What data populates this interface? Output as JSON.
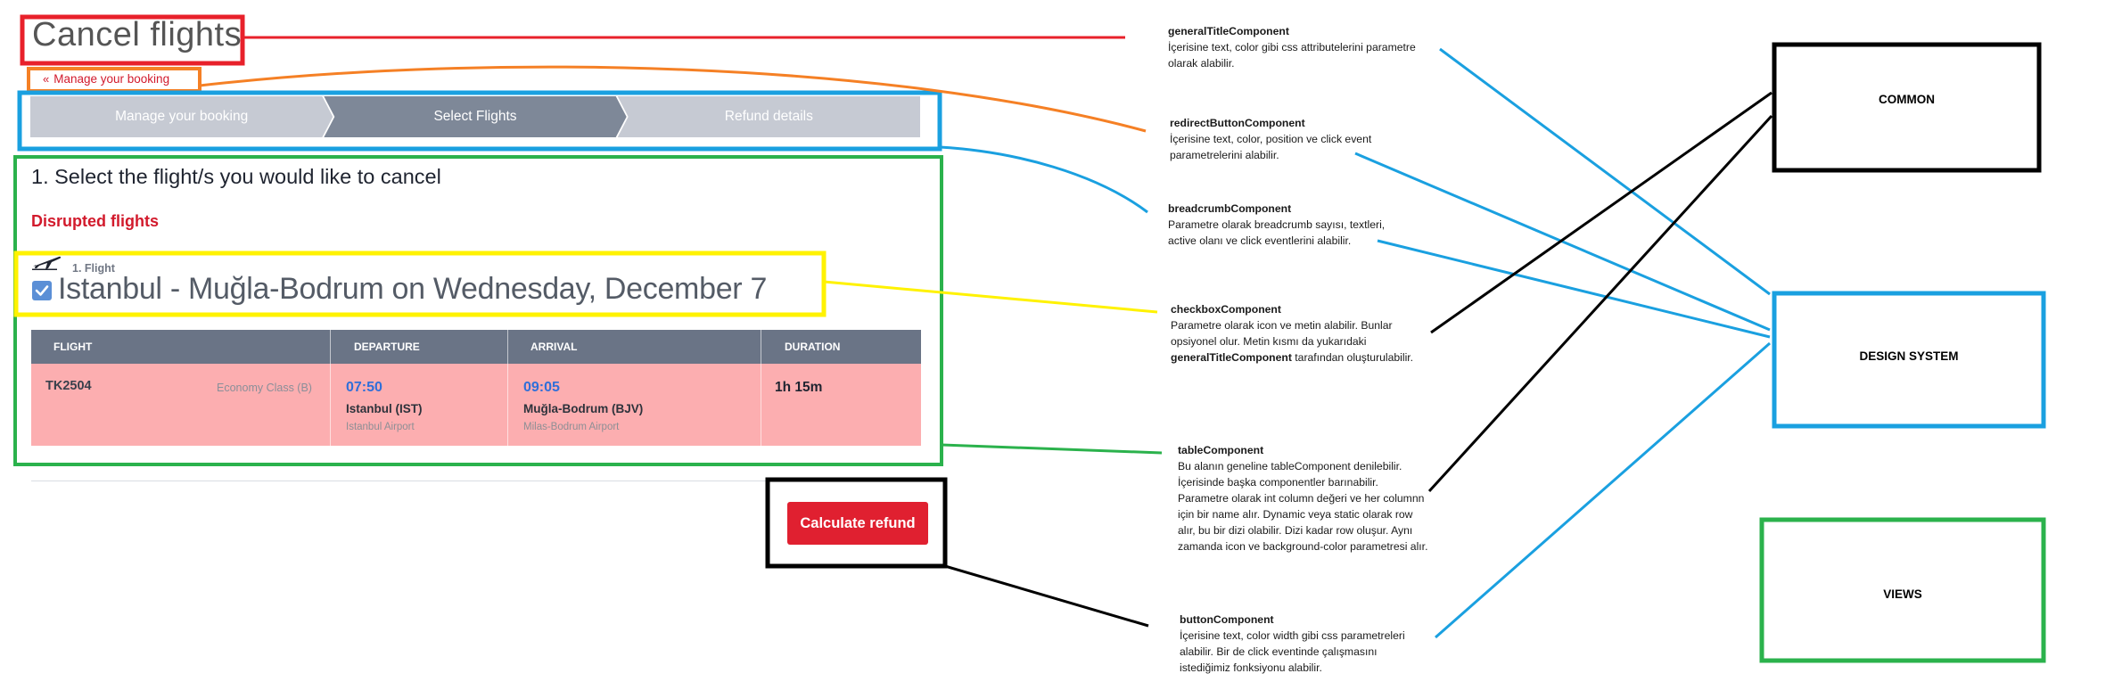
{
  "app": {
    "page_title": "Cancel flights",
    "redirect_label": "Manage your booking",
    "breadcrumb": [
      {
        "label": "Manage your booking",
        "active": false
      },
      {
        "label": "Select Flights",
        "active": true
      },
      {
        "label": "Refund details",
        "active": false
      }
    ],
    "section_heading": "1. Select the flight/s you would like to cancel",
    "disrupted_label": "Disrupted flights",
    "flight_index": "1. Flight",
    "route_title": "Istanbul - Muğla-Bodrum on Wednesday, December 7",
    "checkbox_checked": true,
    "table": {
      "headers": [
        "FLIGHT",
        "DEPARTURE",
        "ARRIVAL",
        "DURATION"
      ],
      "row": {
        "flight_no": "TK2504",
        "class": "Economy Class (B)",
        "dep_time": "07:50",
        "dep_city": "Istanbul (IST)",
        "dep_airport": "Istanbul Airport",
        "arr_time": "09:05",
        "arr_city": "Muğla-Bodrum (BJV)",
        "arr_airport": "Milas-Bodrum Airport",
        "duration": "1h 15m"
      }
    },
    "calculate_button": "Calculate refund"
  },
  "notes": {
    "general_title": {
      "title": "generalTitleComponent",
      "text": "İçerisine text, color gibi css attributelerini parametre\nolarak alabilir."
    },
    "redirect_button": {
      "title": "redirectButtonComponent",
      "text": "İçerisine text, color, position ve click event\nparametrelerini alabilir."
    },
    "breadcrumb": {
      "title": "breadcrumbComponent",
      "text": "Parametre olarak breadcrumb sayısı, textleri,\nactive olanı ve click eventlerini alabilir."
    },
    "checkbox": {
      "title": "checkboxComponent",
      "text_a": "Parametre olarak icon ve metin alabilir. Bunlar\nopsiyonel olur. Metin kısmı da yukarıdaki",
      "text_b_bold": "generalTitleComponent",
      "text_b_rest": " tarafından oluşturulabilir."
    },
    "table": {
      "title": "tableComponent",
      "text": "Bu alanın geneline tableComponent denilebilir.\nİçerisinde başka componentler barınabilir.\nParametre olarak int column değeri ve her columnn\niçin bir name alır. Dynamic veya static olarak row\nalır, bu bir dizi olabilir. Dizi kadar row oluşur. Aynı\nzamanda icon ve background-color parametresi alır."
    },
    "button": {
      "title": "buttonComponent",
      "text": "İçerisine text, color width gibi css parametreleri\nalabilir. Bir de click eventinde çalışmasını\nistediğimiz fonksiyonu alabilir."
    }
  },
  "categories": {
    "common": "COMMON",
    "design_system": "DESIGN SYSTEM",
    "views": "VIEWS"
  },
  "colors": {
    "general_title": "#e8212b",
    "redirect": "#f58025",
    "breadcrumb": "#1aa0e0",
    "views": "#2bb24c",
    "checkbox": "#fff200",
    "button_frame": "#000000",
    "common": "#000000",
    "design_system": "#1aa0e0"
  }
}
